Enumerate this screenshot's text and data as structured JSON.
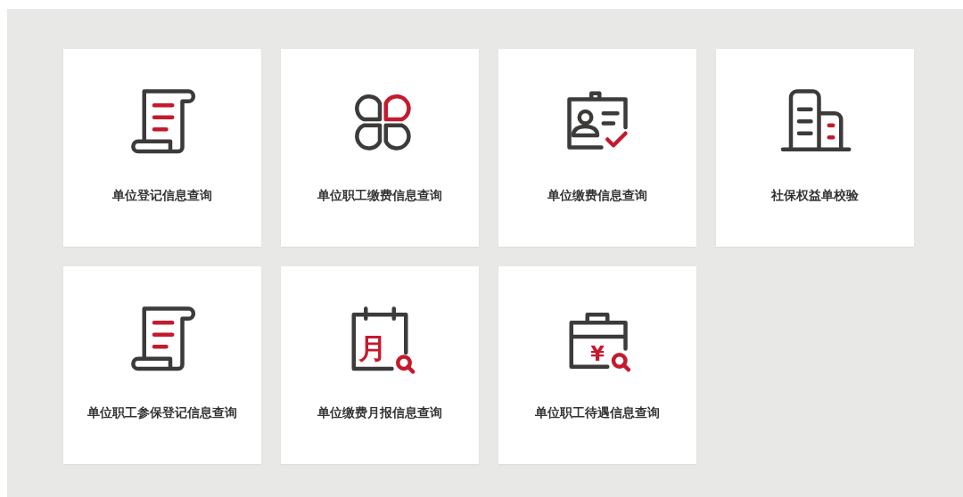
{
  "cards": [
    {
      "kind": "scroll",
      "label": "单位登记信息查询"
    },
    {
      "kind": "clover",
      "label": "单位职工缴费信息查询"
    },
    {
      "kind": "badge",
      "label": "单位缴费信息查询"
    },
    {
      "kind": "building",
      "label": "社保权益单校验"
    },
    {
      "kind": "scroll",
      "label": "单位职工参保登记信息查询"
    },
    {
      "kind": "calendar",
      "label": "单位缴费月报信息查询",
      "glyph": "月"
    },
    {
      "kind": "case",
      "label": "单位职工待遇信息查询",
      "glyph": "¥"
    }
  ]
}
